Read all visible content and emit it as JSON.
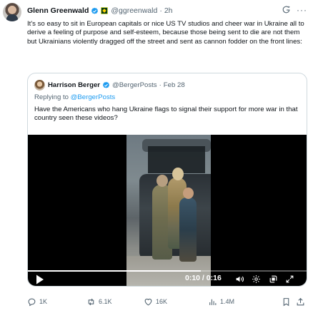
{
  "author": {
    "name": "Glenn Greenwald",
    "handle": "@ggreenwald",
    "time": "2h"
  },
  "tweet": {
    "text": "It's so easy to sit in European capitals or nice US TV studios and cheer war in Ukraine all to derive a feeling of purpose and self-esteem, because those being sent to die are not them but Ukrainians violently dragged off the street and sent as cannon fodder on the front lines:"
  },
  "quote": {
    "name": "Harrison Berger",
    "handle": "@BergerPosts",
    "date": "Feb 28",
    "reply_prefix": "Replying to ",
    "reply_handle": "@BergerPosts",
    "text": "Have the Americans who hang Ukraine flags to signal their support for more war in that country seen these videos?"
  },
  "video": {
    "time": "0:10 / 0:16",
    "progress": 0.62
  },
  "actions": {
    "replies": "1K",
    "reposts": "6.1K",
    "likes": "16K",
    "views": "1.4M"
  },
  "colors": {
    "verified": "#1d9bf0",
    "secondary_text": "#536471",
    "link": "#1d9bf0"
  }
}
